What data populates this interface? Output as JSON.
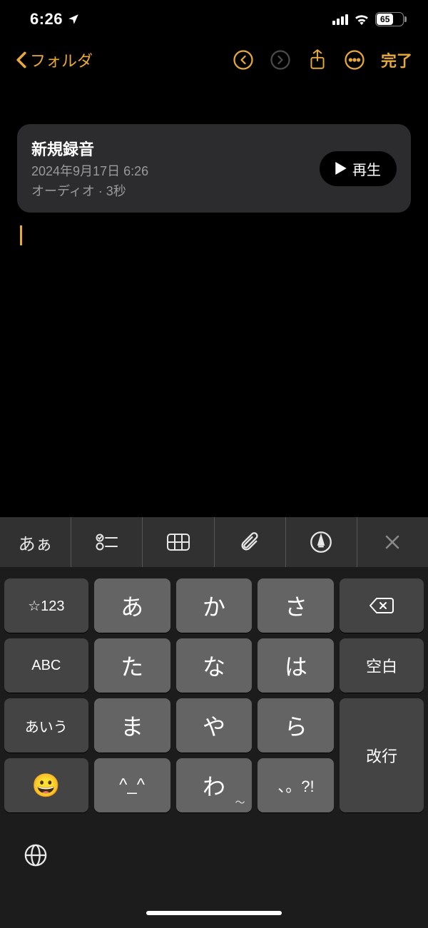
{
  "status": {
    "time": "6:26",
    "battery": "65"
  },
  "nav": {
    "back_label": "フォルダ",
    "done_label": "完了"
  },
  "audio": {
    "title": "新規録音",
    "datetime": "2024年9月17日 6:26",
    "meta": "オーディオ · 3秒",
    "play_label": "再生"
  },
  "toolbar": {
    "format": "あぁ"
  },
  "keys": {
    "r1": {
      "mode": "☆123",
      "a": "あ",
      "ka": "か",
      "sa": "さ"
    },
    "r2": {
      "abc": "ABC",
      "ta": "た",
      "na": "な",
      "ha": "は",
      "space": "空白"
    },
    "r3": {
      "aiu": "あいう",
      "ma": "ま",
      "ya": "や",
      "ra": "ら",
      "enter": "改行"
    },
    "r4": {
      "dakuten": "^_^",
      "wa": "わ",
      "punct": "、。?!"
    }
  }
}
